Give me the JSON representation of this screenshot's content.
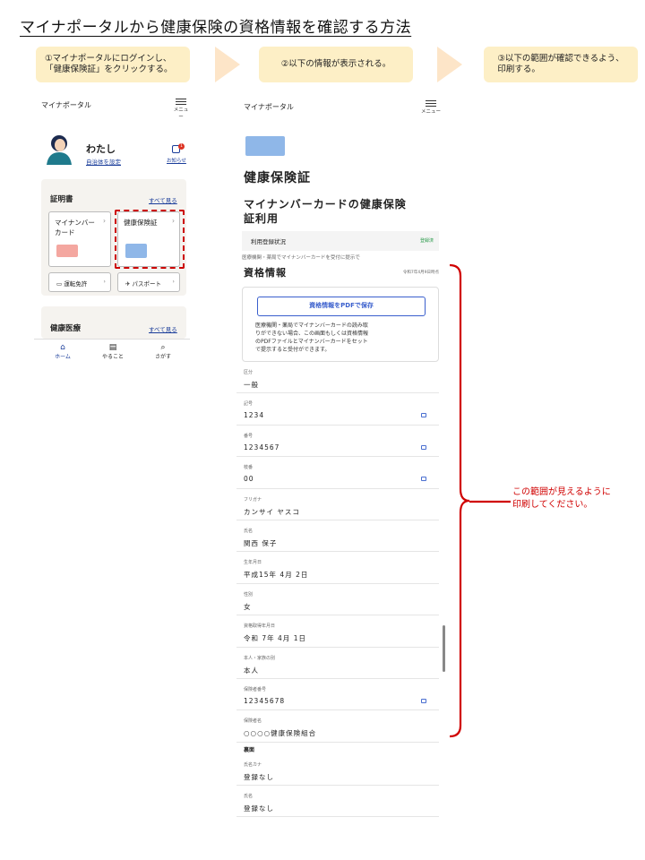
{
  "title": "マイナポータルから健康保険の資格情報を確認する方法",
  "steps": [
    "①マイナポータルにログインし、\n「健康保険証」をクリックする。",
    "②以下の情報が表示される。",
    "③以下の範囲が確認できるよう、\n印刷する。"
  ],
  "phone1": {
    "app_name": "マイナポータル",
    "menu_label": "メニュー",
    "user_name": "わたし",
    "municipality_link": "自治体を設定",
    "notice_label": "お知らせ",
    "notice_badge": "1",
    "certificates_heading": "証明書",
    "see_all": "すべて見る",
    "mynumber_card": "マイナンバー\nカード",
    "insurance_card": "健康保険証",
    "drivers_license": "運転免許",
    "passport": "パスポート",
    "health_heading": "健康医療",
    "nav": [
      "ホーム",
      "やること",
      "さがす"
    ]
  },
  "phone2": {
    "app_name": "マイナポータル",
    "menu_label": "メニュー",
    "page_title": "健康保険証",
    "section_title": "マイナンバーカードの健康保険\n証利用",
    "registration_label": "利用登録状況",
    "registration_status": "登録済",
    "info_text": "医療機関・薬局でマイナンバーカードを受付に提示で",
    "qual_heading": "資格情報",
    "qual_date": "令和7年4月9日時点",
    "pdf_button": "資格情報をPDFで保存",
    "pdf_desc": "医療機関・薬局でマイナンバーカードの読み取\nりができない場合、この画面もしくは資格情報\nのPDFファイルとマイナンバーカードをセット\nで提示すると受付ができます。",
    "fields": [
      {
        "label": "区分",
        "value": "一般"
      },
      {
        "label": "記号",
        "value": "1234"
      },
      {
        "label": "番号",
        "value": "1234567"
      },
      {
        "label": "枝番",
        "value": "00"
      },
      {
        "label": "フリガナ",
        "value": "カンサイ ヤスコ"
      },
      {
        "label": "氏名",
        "value": "関西 保子"
      },
      {
        "label": "生年月日",
        "value": "平成15年 4月 2日"
      },
      {
        "label": "性別",
        "value": "女"
      },
      {
        "label": "資格取得年月日",
        "value": "令和 7年 4月 1日"
      },
      {
        "label": "本人・家族の別",
        "value": "本人"
      },
      {
        "label": "保険者番号",
        "value": "12345678"
      },
      {
        "label": "保険者名",
        "value": "○○○○健康保険組合"
      }
    ],
    "back_heading": "裏面",
    "back_fields": [
      {
        "label": "氏名カナ",
        "value": "登録なし"
      },
      {
        "label": "氏名",
        "value": "登録なし"
      }
    ]
  },
  "annotation": "この範囲が見えるように\n印刷してください。",
  "colors": {
    "accent_red": "#d00000",
    "step_bg": "#fdefc6",
    "link_blue": "#1a3d9a"
  }
}
